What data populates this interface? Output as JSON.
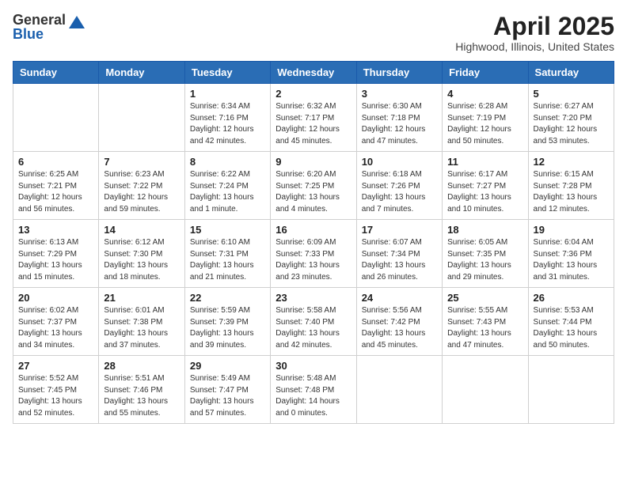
{
  "header": {
    "logo_general": "General",
    "logo_blue": "Blue",
    "title": "April 2025",
    "location": "Highwood, Illinois, United States"
  },
  "weekdays": [
    "Sunday",
    "Monday",
    "Tuesday",
    "Wednesday",
    "Thursday",
    "Friday",
    "Saturday"
  ],
  "weeks": [
    [
      {
        "day": "",
        "info": ""
      },
      {
        "day": "",
        "info": ""
      },
      {
        "day": "1",
        "info": "Sunrise: 6:34 AM\nSunset: 7:16 PM\nDaylight: 12 hours and 42 minutes."
      },
      {
        "day": "2",
        "info": "Sunrise: 6:32 AM\nSunset: 7:17 PM\nDaylight: 12 hours and 45 minutes."
      },
      {
        "day": "3",
        "info": "Sunrise: 6:30 AM\nSunset: 7:18 PM\nDaylight: 12 hours and 47 minutes."
      },
      {
        "day": "4",
        "info": "Sunrise: 6:28 AM\nSunset: 7:19 PM\nDaylight: 12 hours and 50 minutes."
      },
      {
        "day": "5",
        "info": "Sunrise: 6:27 AM\nSunset: 7:20 PM\nDaylight: 12 hours and 53 minutes."
      }
    ],
    [
      {
        "day": "6",
        "info": "Sunrise: 6:25 AM\nSunset: 7:21 PM\nDaylight: 12 hours and 56 minutes."
      },
      {
        "day": "7",
        "info": "Sunrise: 6:23 AM\nSunset: 7:22 PM\nDaylight: 12 hours and 59 minutes."
      },
      {
        "day": "8",
        "info": "Sunrise: 6:22 AM\nSunset: 7:24 PM\nDaylight: 13 hours and 1 minute."
      },
      {
        "day": "9",
        "info": "Sunrise: 6:20 AM\nSunset: 7:25 PM\nDaylight: 13 hours and 4 minutes."
      },
      {
        "day": "10",
        "info": "Sunrise: 6:18 AM\nSunset: 7:26 PM\nDaylight: 13 hours and 7 minutes."
      },
      {
        "day": "11",
        "info": "Sunrise: 6:17 AM\nSunset: 7:27 PM\nDaylight: 13 hours and 10 minutes."
      },
      {
        "day": "12",
        "info": "Sunrise: 6:15 AM\nSunset: 7:28 PM\nDaylight: 13 hours and 12 minutes."
      }
    ],
    [
      {
        "day": "13",
        "info": "Sunrise: 6:13 AM\nSunset: 7:29 PM\nDaylight: 13 hours and 15 minutes."
      },
      {
        "day": "14",
        "info": "Sunrise: 6:12 AM\nSunset: 7:30 PM\nDaylight: 13 hours and 18 minutes."
      },
      {
        "day": "15",
        "info": "Sunrise: 6:10 AM\nSunset: 7:31 PM\nDaylight: 13 hours and 21 minutes."
      },
      {
        "day": "16",
        "info": "Sunrise: 6:09 AM\nSunset: 7:33 PM\nDaylight: 13 hours and 23 minutes."
      },
      {
        "day": "17",
        "info": "Sunrise: 6:07 AM\nSunset: 7:34 PM\nDaylight: 13 hours and 26 minutes."
      },
      {
        "day": "18",
        "info": "Sunrise: 6:05 AM\nSunset: 7:35 PM\nDaylight: 13 hours and 29 minutes."
      },
      {
        "day": "19",
        "info": "Sunrise: 6:04 AM\nSunset: 7:36 PM\nDaylight: 13 hours and 31 minutes."
      }
    ],
    [
      {
        "day": "20",
        "info": "Sunrise: 6:02 AM\nSunset: 7:37 PM\nDaylight: 13 hours and 34 minutes."
      },
      {
        "day": "21",
        "info": "Sunrise: 6:01 AM\nSunset: 7:38 PM\nDaylight: 13 hours and 37 minutes."
      },
      {
        "day": "22",
        "info": "Sunrise: 5:59 AM\nSunset: 7:39 PM\nDaylight: 13 hours and 39 minutes."
      },
      {
        "day": "23",
        "info": "Sunrise: 5:58 AM\nSunset: 7:40 PM\nDaylight: 13 hours and 42 minutes."
      },
      {
        "day": "24",
        "info": "Sunrise: 5:56 AM\nSunset: 7:42 PM\nDaylight: 13 hours and 45 minutes."
      },
      {
        "day": "25",
        "info": "Sunrise: 5:55 AM\nSunset: 7:43 PM\nDaylight: 13 hours and 47 minutes."
      },
      {
        "day": "26",
        "info": "Sunrise: 5:53 AM\nSunset: 7:44 PM\nDaylight: 13 hours and 50 minutes."
      }
    ],
    [
      {
        "day": "27",
        "info": "Sunrise: 5:52 AM\nSunset: 7:45 PM\nDaylight: 13 hours and 52 minutes."
      },
      {
        "day": "28",
        "info": "Sunrise: 5:51 AM\nSunset: 7:46 PM\nDaylight: 13 hours and 55 minutes."
      },
      {
        "day": "29",
        "info": "Sunrise: 5:49 AM\nSunset: 7:47 PM\nDaylight: 13 hours and 57 minutes."
      },
      {
        "day": "30",
        "info": "Sunrise: 5:48 AM\nSunset: 7:48 PM\nDaylight: 14 hours and 0 minutes."
      },
      {
        "day": "",
        "info": ""
      },
      {
        "day": "",
        "info": ""
      },
      {
        "day": "",
        "info": ""
      }
    ]
  ]
}
